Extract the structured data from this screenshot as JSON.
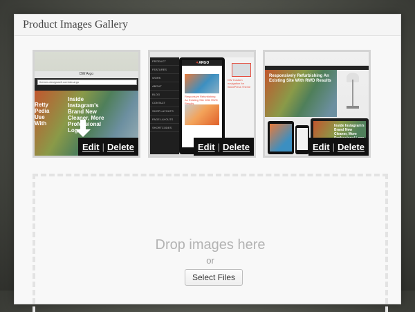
{
  "panel": {
    "title": "Product Images Gallery"
  },
  "gallery": {
    "images": [
      {
        "edit_label": "Edit",
        "separator": "|",
        "delete_label": "Delete",
        "preview": {
          "window_title": "DW Argo",
          "url": "themes.designwell.com/dw-argo",
          "hero_text": "Inside Instagram's Brand New Cleaner, More Professional Logo",
          "side_text": "Retty Pedia Use With"
        }
      },
      {
        "edit_label": "Edit",
        "separator": "|",
        "delete_label": "Delete",
        "preview": {
          "logo": "ARGO",
          "caption": "Responsive Refurbishing An Existing Site With RWD Results",
          "side_caption": "DW Custom navigation for WordPress Theme",
          "menu_items": [
            "PRODUCT",
            "FEATURES",
            "WORK",
            "ABOUT",
            "BLOG",
            "CONTACT",
            "SHOP LAYOUTS",
            "PAGE LAYOUTS",
            "SHORTCODES"
          ]
        }
      },
      {
        "edit_label": "Edit",
        "separator": "|",
        "delete_label": "Delete",
        "preview": {
          "hero_text": "Responsively Refurbishing An Existing Site With RWD Results",
          "laptop_text": "Inside Instagram's Brand New Cleaner, More Professional Logo"
        }
      }
    ]
  },
  "dropzone": {
    "title": "Drop images here",
    "or_text": "or",
    "button_label": "Select Files"
  }
}
